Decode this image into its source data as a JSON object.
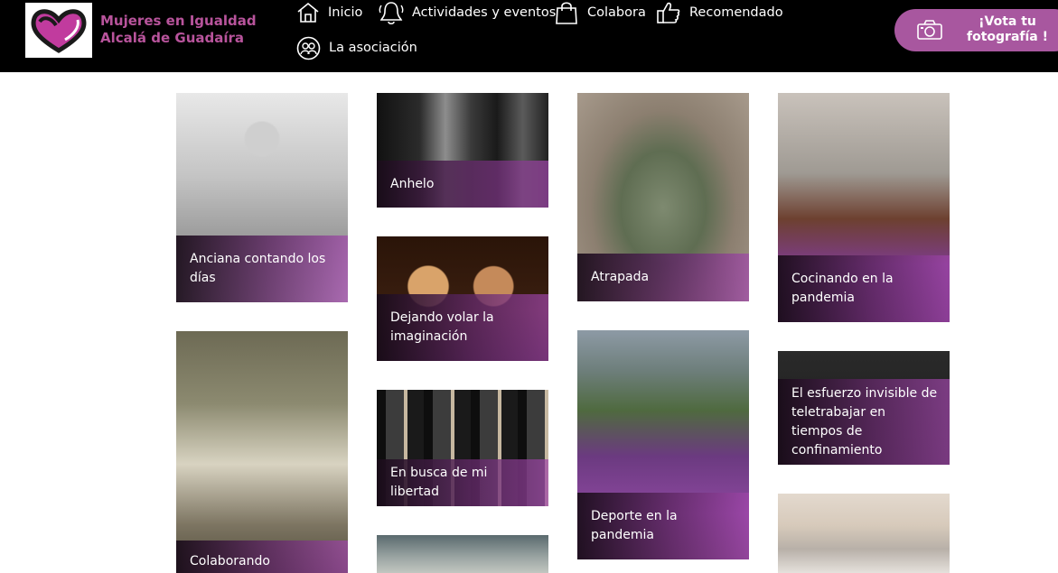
{
  "brand": {
    "line1": "Mujeres en Igualdad",
    "line2": "Alcalá de Guadaíra"
  },
  "nav": [
    {
      "label": "Inicio",
      "icon": "home-icon"
    },
    {
      "label": "Actividades y eventos",
      "icon": "bell-icon"
    },
    {
      "label": "Colabora",
      "icon": "shopping-bag-icon"
    },
    {
      "label": "Recomendado",
      "icon": "thumbs-up-icon"
    },
    {
      "label": "La asociación",
      "icon": "people-circle-icon"
    }
  ],
  "vote": {
    "line1": "¡Vota tu",
    "line2": "fotografía !",
    "icon": "camera-icon"
  },
  "gallery": [
    {
      "caption": "Anciana contando los días"
    },
    {
      "caption": "Anhelo"
    },
    {
      "caption": "Atrapada"
    },
    {
      "caption": "Cocinando en la pandemia"
    },
    {
      "caption": "Colaborando"
    },
    {
      "caption": "Dejando volar la imaginación"
    },
    {
      "caption": "Deporte en la pandemia"
    },
    {
      "caption": "El esfuerzo invisible de teletrabajar en tiempos de confinamiento"
    },
    {
      "caption": "En busca de mi libertad"
    },
    {
      "caption": ""
    },
    {
      "caption": ""
    }
  ],
  "colors": {
    "header_bg": "#000000",
    "brand": "#b8549c",
    "accent": "#a8579f",
    "caption_overlay": "#5f2864"
  }
}
